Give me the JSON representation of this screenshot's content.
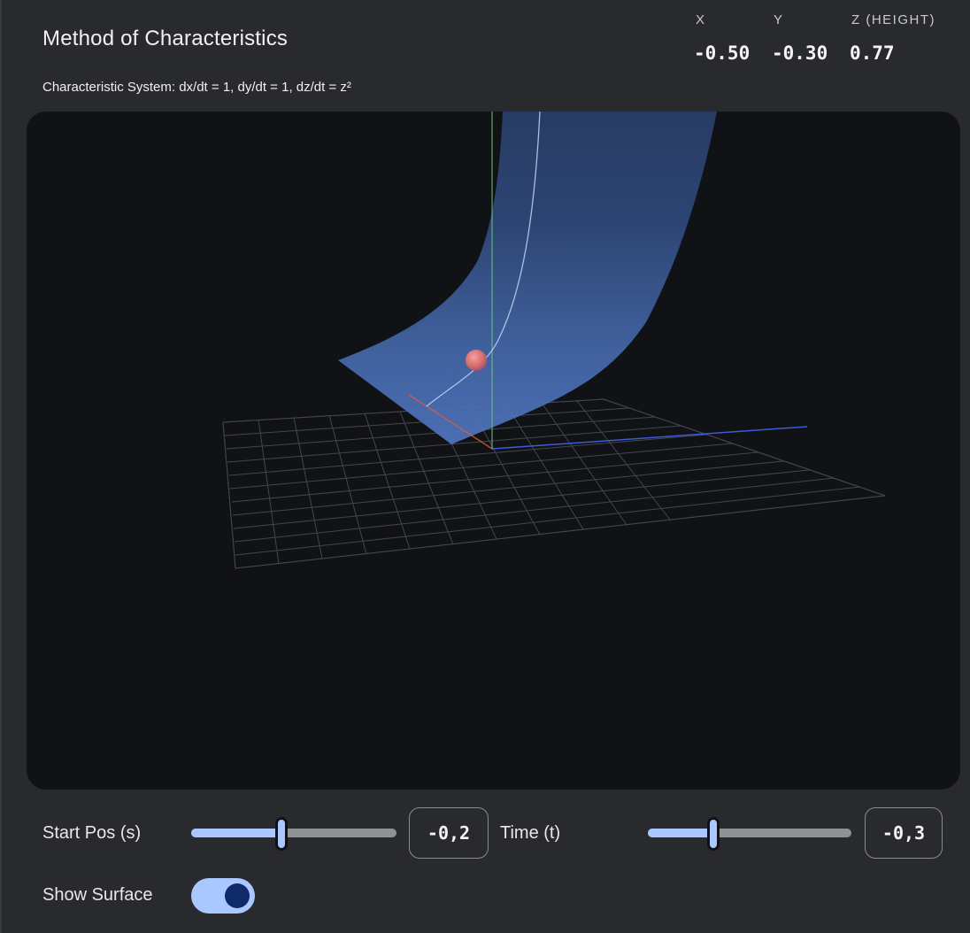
{
  "header": {
    "title": "Method of Characteristics",
    "subtitle": "Characteristic System: dx/dt = 1, dy/dt = 1, dz/dt = z²"
  },
  "readout": {
    "x_label": "X",
    "y_label": "Y",
    "z_label": "Z (HEIGHT)",
    "x_value": "-0.50",
    "y_value": "-0.30",
    "z_value": "0.77"
  },
  "controls": {
    "start_pos": {
      "label": "Start Pos (s)",
      "value_text": "-0,2",
      "fraction": 0.44
    },
    "time": {
      "label": "Time (t)",
      "value_text": "-0,3",
      "fraction": 0.32
    },
    "show_surface": {
      "label": "Show Surface",
      "checked": true
    }
  },
  "colors": {
    "surface": "#4a6fb5",
    "particle": "#e07a7a",
    "grid": "#4b4d55",
    "axis_x": "#d9603b",
    "axis_y": "#3c5bd6",
    "axis_z": "#6fc27a",
    "accent": "#aac7ff"
  }
}
